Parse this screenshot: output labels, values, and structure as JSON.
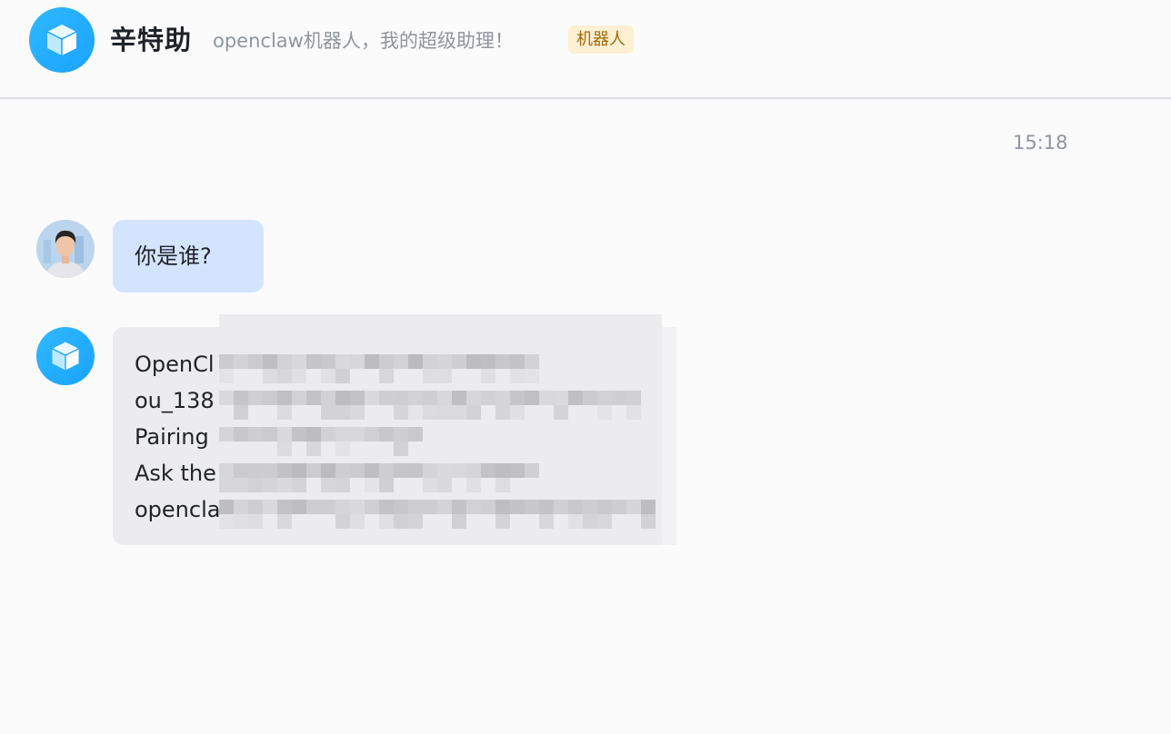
{
  "header": {
    "avatar_icon": "cube-icon",
    "title": "辛特助",
    "subtitle": "openclaw机器人，我的超级助理！",
    "badge": "机器人"
  },
  "chat": {
    "timestamp": "15:18",
    "messages": [
      {
        "sender": "user",
        "avatar": "user-photo",
        "text": "你是谁?"
      },
      {
        "sender": "bot",
        "avatar": "cube-icon",
        "lines": [
          "OpenCl",
          "ou_138",
          "Pairing",
          "Ask the",
          "opencla"
        ]
      }
    ]
  },
  "colors": {
    "accent": "#1aa3ff",
    "user_bubble": "#d4e4fe",
    "bot_bubble": "#ececee",
    "badge_bg": "#fdf0d3",
    "badge_text": "#a3690a"
  }
}
